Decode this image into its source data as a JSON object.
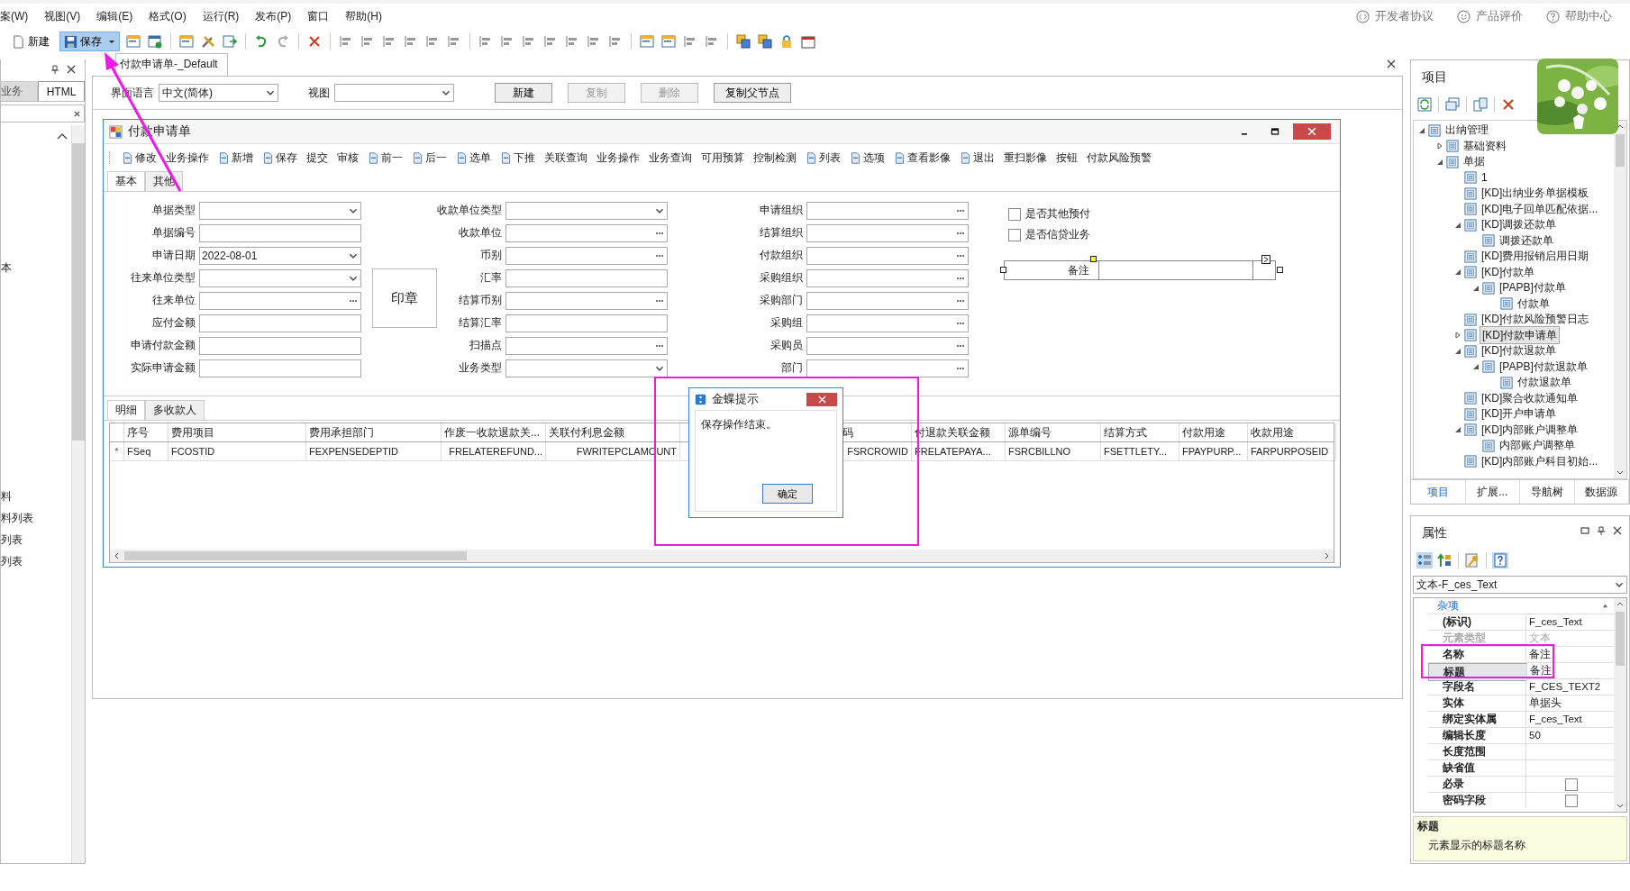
{
  "menu": [
    "案(W)",
    "视图(V)",
    "编辑(E)",
    "格式(O)",
    "运行(R)",
    "发布(P)",
    "窗口",
    "帮助(H)"
  ],
  "help_links": [
    {
      "label": "开发者协议",
      "kind": "code"
    },
    {
      "label": "产品评价",
      "kind": "smile"
    },
    {
      "label": "帮助中心",
      "kind": "question"
    }
  ],
  "toolbar": {
    "new": "新建",
    "save": {
      "label": "保存",
      "highlighted": true
    }
  },
  "left_panel": {
    "tabs": [
      {
        "label": "业务",
        "selected": false
      },
      {
        "label": "HTML",
        "selected": true
      }
    ],
    "items_top": [
      "本"
    ],
    "items_lower": [
      "料",
      "料列表",
      "列表",
      "列表"
    ]
  },
  "document": {
    "tab": "付款申请单-_Default",
    "language_label": "界面语言",
    "language": "中文(简体)",
    "view_label": "视图",
    "buttons": [
      {
        "label": "新建",
        "disabled": false
      },
      {
        "label": "复制",
        "disabled": true
      },
      {
        "label": "删除",
        "disabled": true
      },
      {
        "label": "复制父节点",
        "disabled": false
      }
    ]
  },
  "form": {
    "title": "付款申请单",
    "toolbar": [
      {
        "label": "修改",
        "kind": "icon"
      },
      {
        "label": "业务操作",
        "kind": "plain"
      },
      {
        "label": "新增",
        "kind": "icon"
      },
      {
        "label": "保存",
        "kind": "icon"
      },
      {
        "label": "提交",
        "kind": "plain"
      },
      {
        "label": "审核",
        "kind": "plain"
      },
      {
        "label": "前一",
        "kind": "icon"
      },
      {
        "label": "后一",
        "kind": "icon"
      },
      {
        "label": "选单",
        "kind": "icon"
      },
      {
        "label": "下推",
        "kind": "icon"
      },
      {
        "label": "关联查询",
        "kind": "plain"
      },
      {
        "label": "业务操作",
        "kind": "plain"
      },
      {
        "label": "业务查询",
        "kind": "plain"
      },
      {
        "label": "可用预算",
        "kind": "plain"
      },
      {
        "label": "控制检测",
        "kind": "plain"
      },
      {
        "label": "列表",
        "kind": "icon"
      },
      {
        "label": "选项",
        "kind": "icon"
      },
      {
        "label": "查看影像",
        "kind": "icon"
      },
      {
        "label": "退出",
        "kind": "icon"
      },
      {
        "label": "重扫影像",
        "kind": "plain"
      },
      {
        "label": "按钮",
        "kind": "plain"
      },
      {
        "label": "付款风险预警",
        "kind": "plain"
      }
    ],
    "tabs": [
      {
        "label": "基本",
        "selected": true
      },
      {
        "label": "其他",
        "selected": false
      }
    ],
    "columns": [
      [
        {
          "label": "单据类型",
          "kind": "dropdown"
        },
        {
          "label": "单据编号",
          "kind": "text"
        },
        {
          "label": "申请日期",
          "kind": "dropdown",
          "value": "2022-08-01"
        },
        {
          "label": "往来单位类型",
          "kind": "dropdown"
        },
        {
          "label": "往来单位",
          "kind": "lookup"
        },
        {
          "label": "应付金额",
          "kind": "text"
        },
        {
          "label": "申请付款金额",
          "kind": "text"
        },
        {
          "label": "实际申请金额",
          "kind": "text"
        }
      ],
      [
        {
          "label": "收款单位类型",
          "kind": "dropdown"
        },
        {
          "label": "收款单位",
          "kind": "lookup"
        },
        {
          "label": "币别",
          "kind": "lookup"
        },
        {
          "label": "汇率",
          "kind": "text"
        },
        {
          "label": "结算币别",
          "kind": "lookup"
        },
        {
          "label": "结算汇率",
          "kind": "text"
        },
        {
          "label": "扫描点",
          "kind": "lookup"
        },
        {
          "label": "业务类型",
          "kind": "dropdown"
        }
      ],
      [
        {
          "label": "申请组织",
          "kind": "lookup"
        },
        {
          "label": "结算组织",
          "kind": "lookup"
        },
        {
          "label": "付款组织",
          "kind": "lookup"
        },
        {
          "label": "采购组织",
          "kind": "lookup"
        },
        {
          "label": "采购部门",
          "kind": "lookup"
        },
        {
          "label": "采购组",
          "kind": "lookup"
        },
        {
          "label": "采购员",
          "kind": "lookup"
        },
        {
          "label": "部门",
          "kind": "lookup"
        }
      ]
    ],
    "stamp": "印章",
    "checkboxes": [
      {
        "label": "是否其他预付",
        "checked": false
      },
      {
        "label": "是否信贷业务",
        "checked": false
      }
    ],
    "remark": {
      "label": "备注"
    },
    "detail_tabs": [
      {
        "label": "明细",
        "selected": true
      },
      {
        "label": "多收款人",
        "selected": false
      }
    ],
    "grid_columns": [
      "序号",
      "费用项目",
      "费用承担部门",
      "作废一收款退款关...",
      "关联付利息金额",
      "码",
      "付退款关联金额",
      "源单编号",
      "结算方式",
      "付款用途",
      "收款用途"
    ],
    "grid_rows": [
      {
        "marker": "*",
        "cells": [
          "FSeq",
          "FCOSTID",
          "FEXPENSEDEPTID",
          "FRELATEREFUND...",
          "FWRITEPCLAMOUNT",
          "FSRCROWID",
          "FRELATEPAYA...",
          "FSRCBILLNO",
          "FSETTLETY...",
          "FPAYPURP...",
          "FARPURPOSEID"
        ]
      }
    ]
  },
  "dialog": {
    "title": "金蝶提示",
    "message": "保存操作结束。",
    "button": "确定"
  },
  "project_panel": {
    "title": "项目",
    "tree": [
      {
        "label": "出纳管理",
        "expanded": true,
        "selected": false,
        "children": [
          {
            "label": "基础资料",
            "expanded": false,
            "selected": false
          },
          {
            "label": "单据",
            "expanded": true,
            "selected": false,
            "children": [
              {
                "label": "1",
                "selected": false
              },
              {
                "label": "[KD]出纳业务单据模板",
                "selected": false
              },
              {
                "label": "[KD]电子回单匹配依据...",
                "selected": false
              },
              {
                "label": "[KD]调拨还款单",
                "expanded": true,
                "selected": false,
                "children": [
                  {
                    "label": "调拨还款单",
                    "selected": false
                  }
                ]
              },
              {
                "label": "[KD]费用报销启用日期",
                "selected": false
              },
              {
                "label": "[KD]付款单",
                "expanded": true,
                "selected": false,
                "children": [
                  {
                    "label": "[PAPB]付款单",
                    "expanded": true,
                    "selected": false,
                    "children": [
                      {
                        "label": "付款单",
                        "selected": false
                      }
                    ]
                  }
                ]
              },
              {
                "label": "[KD]付款风险预警日志",
                "selected": false
              },
              {
                "label": "[KD]付款申请单",
                "expanded": false,
                "selected": true
              },
              {
                "label": "[KD]付款退款单",
                "expanded": true,
                "selected": false,
                "children": [
                  {
                    "label": "[PAPB]付款退款单",
                    "expanded": true,
                    "selected": false,
                    "children": [
                      {
                        "label": "付款退款单",
                        "selected": false
                      }
                    ]
                  }
                ]
              },
              {
                "label": "[KD]聚合收款通知单",
                "selected": false
              },
              {
                "label": "[KD]开户申请单",
                "selected": false
              },
              {
                "label": "[KD]内部账户调整单",
                "expanded": true,
                "selected": false,
                "children": [
                  {
                    "label": "内部账户调整单",
                    "selected": false
                  }
                ]
              },
              {
                "label": "[KD]内部账户科目初始...",
                "selected": false
              }
            ]
          }
        ]
      }
    ],
    "tabs": [
      {
        "label": "项目",
        "selected": true
      },
      {
        "label": "扩展...",
        "selected": false
      },
      {
        "label": "导航树",
        "selected": false
      },
      {
        "label": "数据源",
        "selected": false
      }
    ]
  },
  "properties": {
    "title": "属性",
    "selector": "文本-F_ces_Text",
    "category": "杂项",
    "rows": [
      {
        "name": "(标识)",
        "value": "F_ces_Text",
        "kind": "text",
        "disabled": false,
        "selected": false
      },
      {
        "name": "元素类型",
        "value": "文本",
        "kind": "text",
        "disabled": true,
        "selected": false
      },
      {
        "name": "名称",
        "value": "备注",
        "kind": "text",
        "disabled": false,
        "selected": false
      },
      {
        "name": "标题",
        "value": "备注",
        "kind": "text",
        "disabled": false,
        "selected": true
      },
      {
        "name": "字段名",
        "value": "F_CES_TEXT2",
        "kind": "text",
        "disabled": false,
        "selected": false
      },
      {
        "name": "实体",
        "value": "单据头",
        "kind": "text",
        "disabled": false,
        "selected": false
      },
      {
        "name": "绑定实体属",
        "value": "F_ces_Text",
        "kind": "text",
        "disabled": false,
        "selected": false
      },
      {
        "name": "编辑长度",
        "value": "50",
        "kind": "text",
        "disabled": false,
        "selected": false
      },
      {
        "name": "长度范围",
        "kind": "text",
        "disabled": false,
        "selected": false
      },
      {
        "name": "缺省值",
        "kind": "text",
        "disabled": false,
        "selected": false
      },
      {
        "name": "必录",
        "kind": "checkbox",
        "checked": false,
        "disabled": false,
        "selected": false
      },
      {
        "name": "密码字段",
        "kind": "checkbox",
        "checked": false,
        "disabled": false,
        "selected": false
      }
    ],
    "help": {
      "title": "标题",
      "text": "元素显示的标题名称"
    }
  }
}
